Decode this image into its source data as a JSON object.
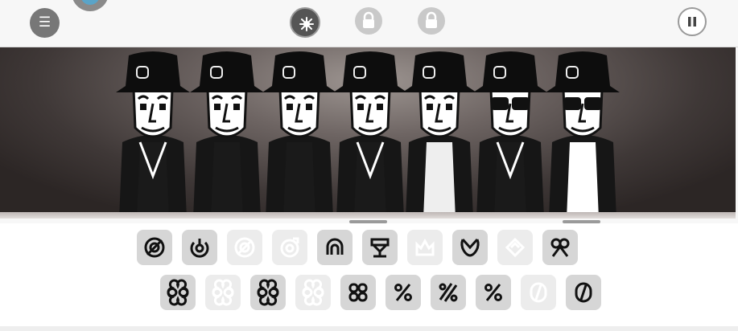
{
  "topbar": {
    "menu_icon": "☰",
    "badge": "character-badge-icon",
    "bonuses": [
      {
        "icon": "bonus-sparkle-icon",
        "state": "active"
      },
      {
        "icon": "lock-icon",
        "state": "locked"
      },
      {
        "icon": "lock-icon",
        "state": "locked"
      }
    ],
    "pause_icon": "pause-icon"
  },
  "stage": {
    "characters": [
      "singer-1",
      "singer-2",
      "singer-3",
      "singer-4",
      "singer-5",
      "singer-6",
      "singer-7"
    ]
  },
  "tray": {
    "row1": [
      {
        "icon": "target-sound-icon",
        "state": "available"
      },
      {
        "icon": "power-sound-icon",
        "state": "available"
      },
      {
        "icon": "target-sound-icon",
        "state": "used"
      },
      {
        "icon": "arrow-target-sound-icon",
        "state": "used"
      },
      {
        "icon": "arch-sound-icon",
        "state": "available"
      },
      {
        "icon": "stand-sound-icon",
        "state": "available"
      },
      {
        "icon": "crown-sound-icon",
        "state": "used"
      },
      {
        "icon": "loop-sound-icon",
        "state": "available"
      },
      {
        "icon": "diamond-sound-icon",
        "state": "used"
      },
      {
        "icon": "double-loop-sound-icon",
        "state": "available"
      }
    ],
    "row2": [
      {
        "icon": "clover-sound-icon",
        "state": "available"
      },
      {
        "icon": "clover-sound-icon",
        "state": "used"
      },
      {
        "icon": "clover-sound-icon",
        "state": "available"
      },
      {
        "icon": "clover-sound-icon",
        "state": "used"
      },
      {
        "icon": "square-clover-sound-icon",
        "state": "available"
      },
      {
        "icon": "percent-sound-icon",
        "state": "available"
      },
      {
        "icon": "double-percent-sound-icon",
        "state": "available"
      },
      {
        "icon": "percent-sound-icon",
        "state": "available"
      },
      {
        "icon": "zero-sound-icon",
        "state": "used"
      },
      {
        "icon": "zero-sound-icon",
        "state": "available"
      }
    ]
  },
  "colors": {
    "active": "#555555",
    "available_bg": "#d6d6d6",
    "used_bg": "#ececec",
    "glyph": "#111111",
    "glyph_used": "#ffffff"
  }
}
